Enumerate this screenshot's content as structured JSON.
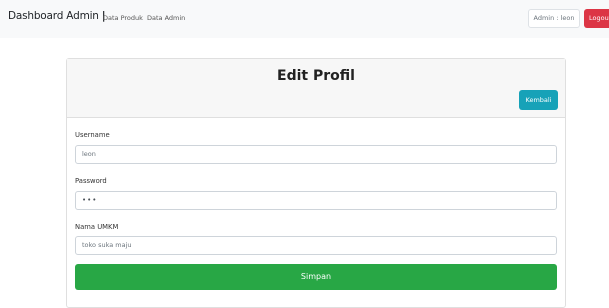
{
  "navbar": {
    "brand": "Dashboard Admin",
    "brand_separator": "|",
    "links": [
      "Data Produk",
      "Data Admin"
    ],
    "admin_label": "Admin : leon",
    "logout_label": "Logout"
  },
  "card": {
    "title": "Edit Profil",
    "back_label": "Kembali",
    "fields": [
      {
        "label": "Username",
        "value": "leon",
        "type": "text"
      },
      {
        "label": "Password",
        "value": "•••",
        "type": "password"
      },
      {
        "label": "Nama UMKM",
        "value": "toko suka maju",
        "type": "text"
      }
    ],
    "submit_label": "Simpan"
  },
  "colors": {
    "navbar_bg": "#f8f9fa",
    "logout": "#dc3545",
    "back": "#17a2b8",
    "submit": "#28a745"
  }
}
